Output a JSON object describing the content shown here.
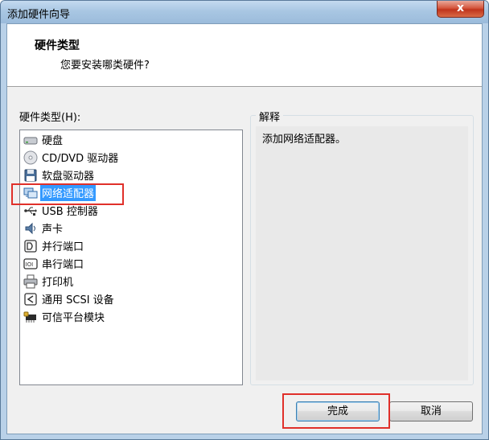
{
  "window": {
    "title": "添加硬件向导",
    "close_label": "x"
  },
  "header": {
    "title": "硬件类型",
    "subtitle": "您要安装哪类硬件?"
  },
  "list": {
    "label": "硬件类型(H):",
    "items": [
      {
        "label": "硬盘",
        "icon": "hard-disk-icon"
      },
      {
        "label": "CD/DVD 驱动器",
        "icon": "cd-dvd-icon"
      },
      {
        "label": "软盘驱动器",
        "icon": "floppy-icon"
      },
      {
        "label": "网络适配器",
        "icon": "network-adapter-icon",
        "selected": true
      },
      {
        "label": "USB 控制器",
        "icon": "usb-icon"
      },
      {
        "label": "声卡",
        "icon": "sound-card-icon"
      },
      {
        "label": "并行端口",
        "icon": "parallel-port-icon"
      },
      {
        "label": "串行端口",
        "icon": "serial-port-icon"
      },
      {
        "label": "打印机",
        "icon": "printer-icon"
      },
      {
        "label": "通用 SCSI 设备",
        "icon": "scsi-icon"
      },
      {
        "label": "可信平台模块",
        "icon": "tpm-icon"
      }
    ]
  },
  "explanation": {
    "title": "解释",
    "text": "添加网络适配器。"
  },
  "buttons": {
    "finish": "完成",
    "cancel": "取消"
  },
  "colors": {
    "selection": "#3399ff",
    "annotation_red": "#e0302a"
  }
}
